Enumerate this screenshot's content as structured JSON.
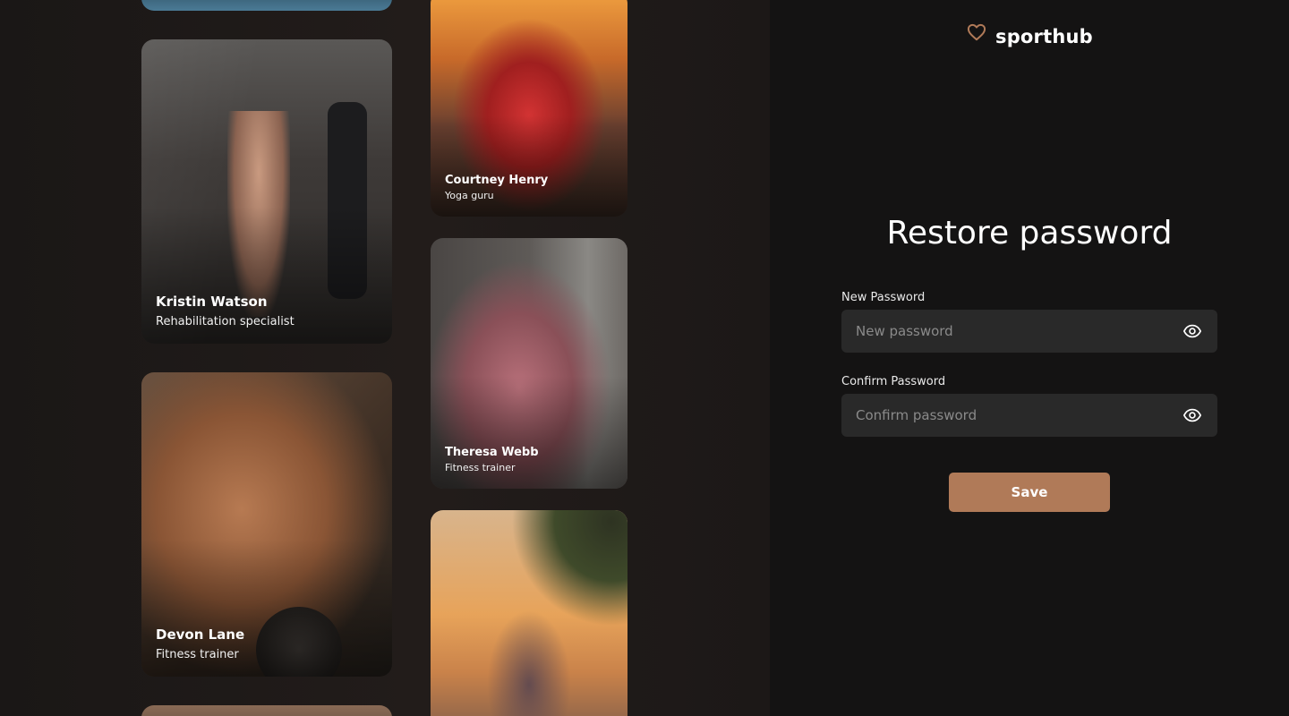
{
  "brand": {
    "name": "sporthub",
    "icon": "heart-icon",
    "accent": "#b07a58"
  },
  "trainers": [
    {
      "name": "Kristin Watson",
      "role": "Rehabilitation specialist"
    },
    {
      "name": "Devon Lane",
      "role": "Fitness trainer"
    },
    {
      "name": "Courtney Henry",
      "role": "Yoga guru"
    },
    {
      "name": "Theresa Webb",
      "role": "Fitness trainer"
    }
  ],
  "form": {
    "title": "Restore password",
    "new_password": {
      "label": "New Password",
      "placeholder": "New password",
      "icon": "eye-icon"
    },
    "confirm_password": {
      "label": "Confirm Password",
      "placeholder": "Confirm password",
      "icon": "eye-icon"
    },
    "save_label": "Save"
  },
  "colors": {
    "background": "#141313",
    "field": "#292929",
    "button": "#b07a58"
  }
}
